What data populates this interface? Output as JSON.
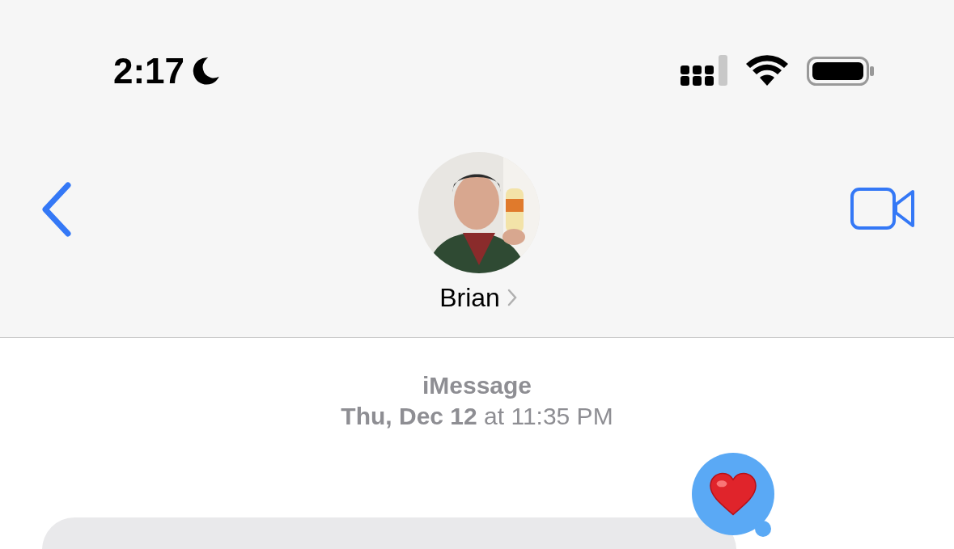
{
  "status_bar": {
    "time": "2:17",
    "focus_on": true
  },
  "header": {
    "contact_name": "Brian"
  },
  "conversation": {
    "service": "iMessage",
    "timestamp": "**Thu, Dec 12** at 11:35 PM"
  },
  "last_message": {
    "reaction": {
      "kind": "heart"
    }
  }
}
